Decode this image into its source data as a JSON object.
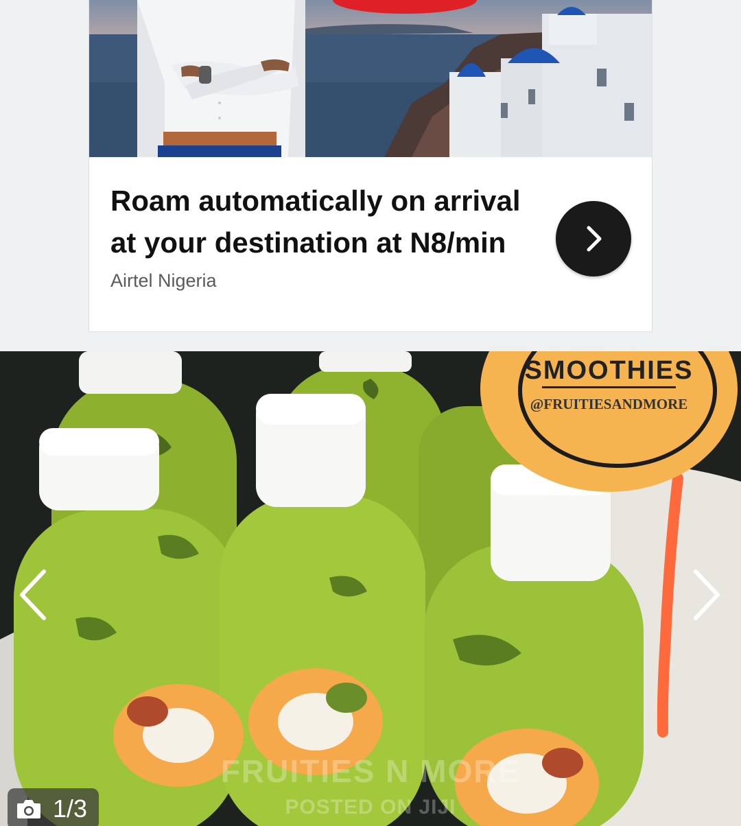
{
  "ad": {
    "title": "Roam automatically on arrival\nat your destination at N8/min",
    "sponsor": "Airtel Nigeria"
  },
  "gallery": {
    "brand_title": "SMOOTHIES",
    "brand_handle": "@FRUITIESANDMORE",
    "watermark": "FRUITIES N MORE",
    "watermark_sub": "POSTED ON JIJI",
    "counter": "1/3",
    "image_index": 1,
    "image_total": 3
  },
  "icons": {
    "ad_cta": "chevron-right-icon",
    "prev": "chevron-left-icon",
    "next": "chevron-right-icon",
    "counter": "camera-icon"
  },
  "colors": {
    "page_background": "#eef0f2",
    "cta_button": "#1a1a1a",
    "badge": "#f6b451",
    "smoothie_green": "#9ec43a"
  }
}
